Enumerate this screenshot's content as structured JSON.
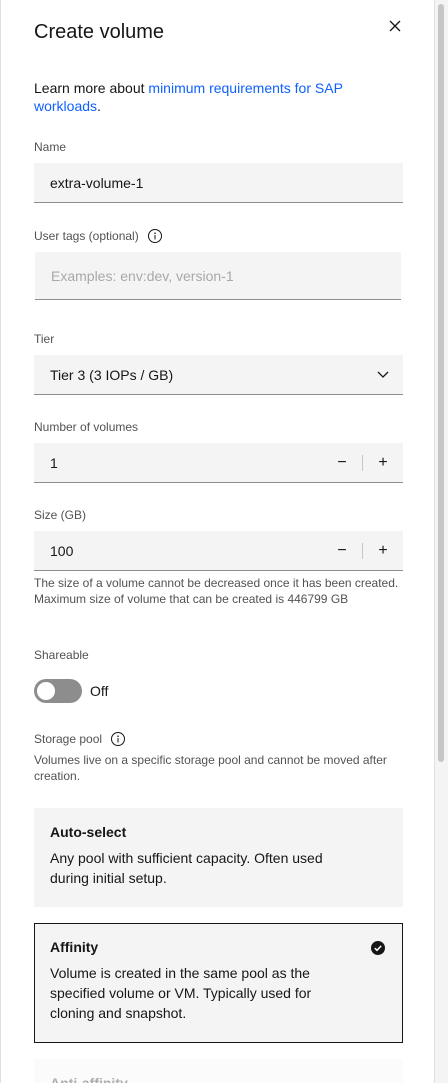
{
  "title": "Create volume",
  "intro": {
    "prefix": "Learn more about ",
    "link": "minimum requirements for SAP workloads",
    "suffix": "."
  },
  "name": {
    "label": "Name",
    "value": "extra-volume-1"
  },
  "tags": {
    "label": "User tags (optional)",
    "placeholder": "Examples: env:dev, version-1"
  },
  "tier": {
    "label": "Tier",
    "value": "Tier 3 (3 IOPs / GB)"
  },
  "count": {
    "label": "Number of volumes",
    "value": "1",
    "decrement": "−",
    "increment": "+"
  },
  "size": {
    "label": "Size (GB)",
    "value": "100",
    "decrement": "−",
    "increment": "+",
    "helper": "The size of a volume cannot be decreased once it has been created. Maximum size of volume that can be created is 446799 GB"
  },
  "shareable": {
    "label": "Shareable",
    "state": "Off"
  },
  "storage_pool": {
    "label": "Storage pool",
    "description": "Volumes live on a specific storage pool and cannot be moved after creation.",
    "options": [
      {
        "title": "Auto-select",
        "description": "Any pool with sufficient capacity. Often used during initial setup."
      },
      {
        "title": "Affinity",
        "description": "Volume is created in the same pool as the specified volume or VM. Typically used for cloning and snapshot."
      },
      {
        "title": "Anti-affinity"
      }
    ]
  },
  "colors": {
    "link": "#0f62fe",
    "field_bg": "#f4f4f4",
    "toggle_off": "#8d8d8d"
  }
}
